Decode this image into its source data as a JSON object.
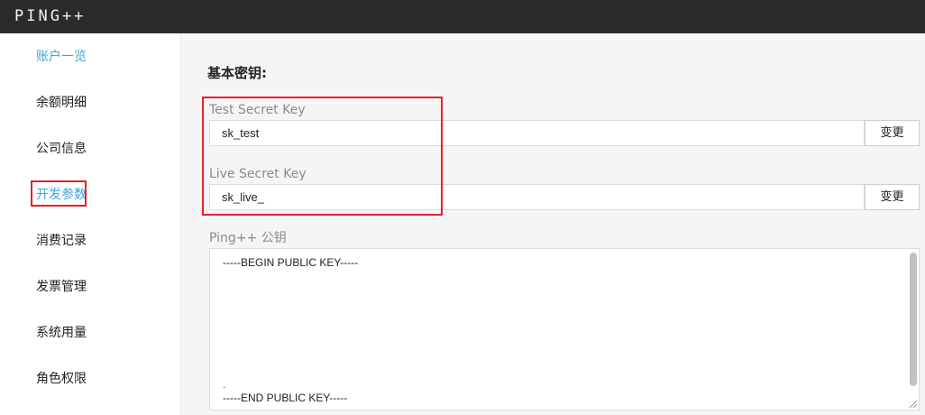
{
  "header": {
    "logo": "PING++"
  },
  "sidebar": {
    "items": [
      {
        "label": "账户一览"
      },
      {
        "label": "余额明细"
      },
      {
        "label": "公司信息"
      },
      {
        "label": "开发参数"
      },
      {
        "label": "消费记录"
      },
      {
        "label": "发票管理"
      },
      {
        "label": "系统用量"
      },
      {
        "label": "角色权限"
      }
    ]
  },
  "main": {
    "section_title": "基本密钥:",
    "test_key": {
      "label": "Test Secret Key",
      "value": "sk_test",
      "button": "变更"
    },
    "live_key": {
      "label": "Live Secret Key",
      "value": "sk_live_",
      "button": "变更"
    },
    "public_key": {
      "label": "Ping++ 公钥",
      "begin": "-----BEGIN PUBLIC KEY-----",
      "dot": ".",
      "end": "-----END PUBLIC KEY-----"
    }
  },
  "colors": {
    "accent": "#3fa6d8",
    "highlight": "#e8202a",
    "topbar": "#2b2b2b"
  }
}
